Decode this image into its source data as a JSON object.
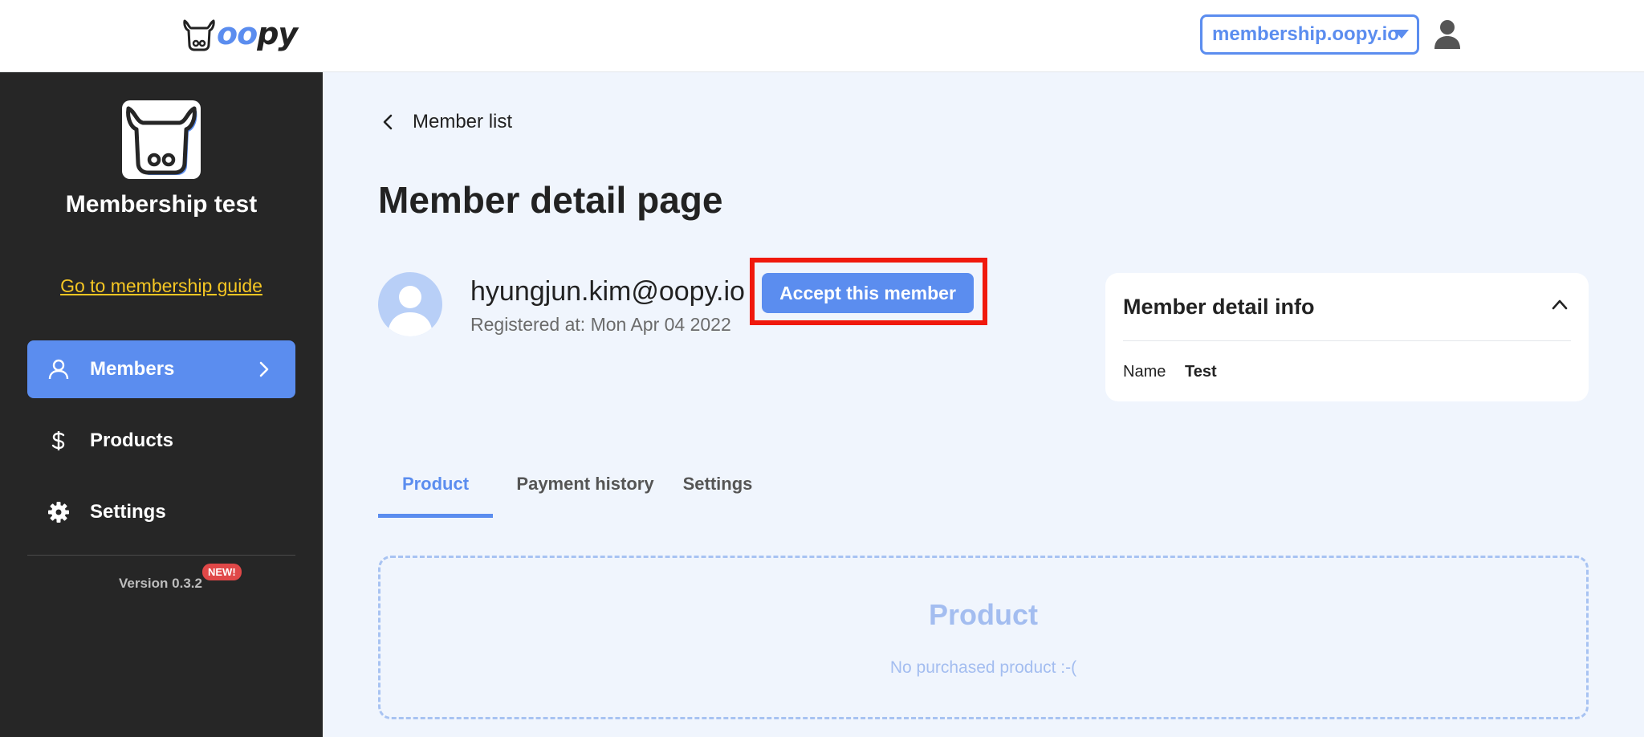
{
  "header": {
    "logo_text_blue": "oo",
    "logo_text_dark": "py",
    "domain_select": "membership.oopy.io"
  },
  "sidebar": {
    "site_name": "Membership test",
    "guide_link": "Go to membership guide",
    "items": [
      {
        "label": "Members",
        "icon": "user-icon",
        "active": true
      },
      {
        "label": "Products",
        "icon": "dollar-icon",
        "active": false
      },
      {
        "label": "Settings",
        "icon": "gear-icon",
        "active": false
      }
    ],
    "version": "Version 0.3.2",
    "badge": "NEW!"
  },
  "main": {
    "back_link": "Member list",
    "title": "Member detail page",
    "member": {
      "email": "hyungjun.kim@oopy.io",
      "registered": "Registered at: Mon Apr 04 2022"
    },
    "accept_button": "Accept this member",
    "info_card": {
      "title": "Member detail info",
      "fields": [
        {
          "key": "Name",
          "value": "Test"
        }
      ]
    },
    "tabs": [
      {
        "label": "Product",
        "active": true
      },
      {
        "label": "Payment history",
        "active": false
      },
      {
        "label": "Settings",
        "active": false
      }
    ],
    "panel": {
      "title": "Product",
      "subtitle": "No purchased product :-("
    }
  },
  "colors": {
    "accent": "#5b8def",
    "sidebar_bg": "#262626",
    "highlight_frame": "#f0190d",
    "guide_link": "#f5c623"
  }
}
